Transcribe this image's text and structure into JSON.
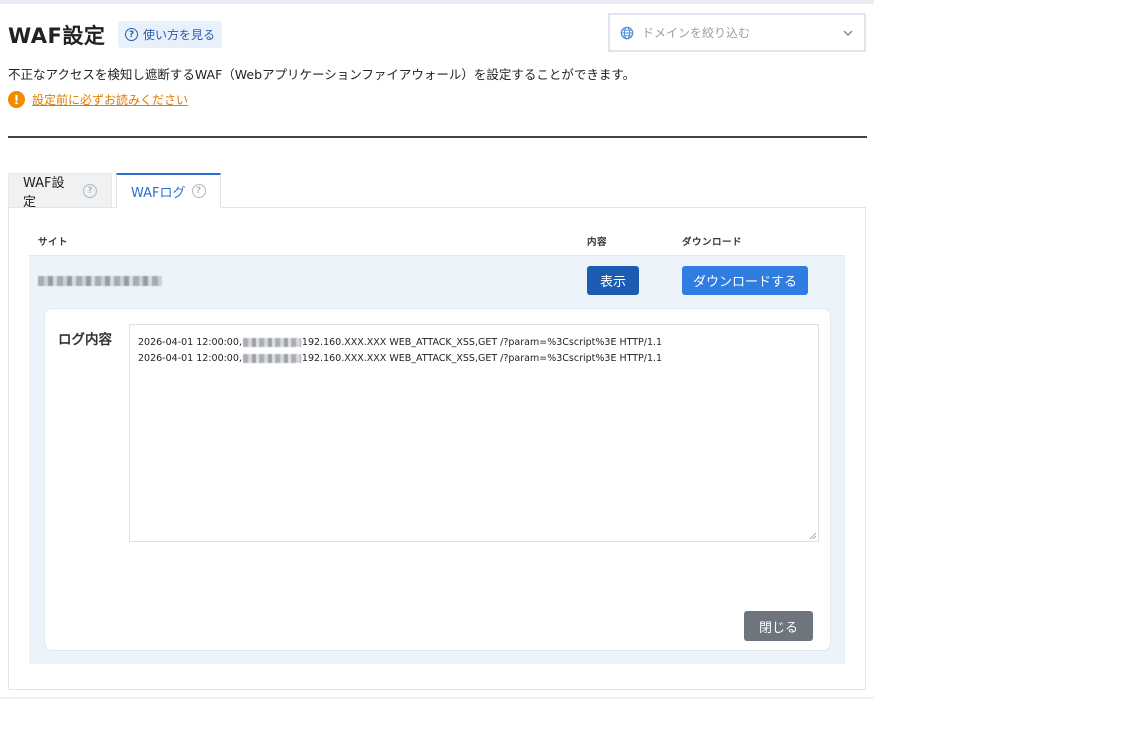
{
  "header": {
    "title": "WAF設定",
    "help_label": "使い方を見る",
    "domain_filter_placeholder": "ドメインを絞り込む"
  },
  "description": "不正なアクセスを検知し遮断するWAF（Webアプリケーションファイアウォール）を設定することができます。",
  "notice": {
    "link_text": "設定前に必ずお読みください",
    "icon_text": "!"
  },
  "tabs": [
    {
      "label": "WAF設定",
      "active": false
    },
    {
      "label": "WAFログ",
      "active": true
    }
  ],
  "help_glyph": "?",
  "table": {
    "headers": {
      "site": "サイト",
      "content": "内容",
      "download": "ダウンロード"
    },
    "row": {
      "show_label": "表示",
      "download_label": "ダウンロードする"
    }
  },
  "log_panel": {
    "label": "ログ内容",
    "lines": [
      {
        "prefix": "2026-04-01 12:00:00,",
        "suffix": "192.160.XXX.XXX WEB_ATTACK_XSS,GET /?param=%3Cscript%3E HTTP/1.1"
      },
      {
        "prefix": "2026-04-01 12:00:00,",
        "suffix": "192.160.XXX.XXX WEB_ATTACK_XSS,GET /?param=%3Cscript%3E HTTP/1.1"
      }
    ],
    "close_label": "閉じる"
  },
  "colors": {
    "accent": "#2f7de0",
    "show_button": "#1d5cb3",
    "close_button": "#6e757c",
    "warning": "#f08c00"
  }
}
